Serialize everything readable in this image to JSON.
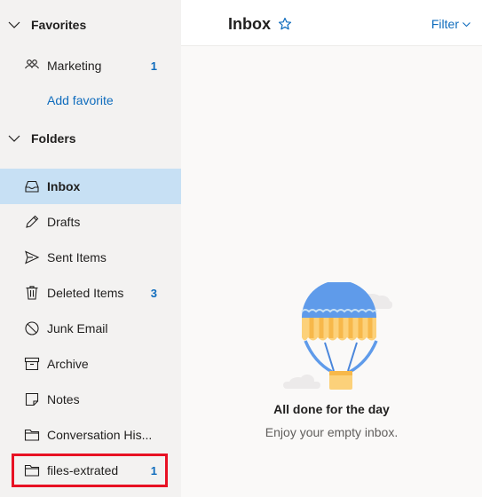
{
  "sidebar": {
    "favorites_header": "Favorites",
    "folders_header": "Folders",
    "add_favorite": "Add favorite",
    "favorites": [
      {
        "label": "Marketing",
        "count": "1",
        "icon": "people-icon"
      }
    ],
    "folders": [
      {
        "label": "Inbox",
        "count": "",
        "icon": "inbox-icon",
        "selected": true
      },
      {
        "label": "Drafts",
        "count": "",
        "icon": "pencil-icon"
      },
      {
        "label": "Sent Items",
        "count": "",
        "icon": "send-icon"
      },
      {
        "label": "Deleted Items",
        "count": "3",
        "icon": "trash-icon"
      },
      {
        "label": "Junk Email",
        "count": "",
        "icon": "block-icon"
      },
      {
        "label": "Archive",
        "count": "",
        "icon": "archive-icon"
      },
      {
        "label": "Notes",
        "count": "",
        "icon": "note-icon"
      },
      {
        "label": "Conversation His...",
        "count": "",
        "icon": "folder-icon"
      },
      {
        "label": "files-extrated",
        "count": "1",
        "icon": "folder-icon"
      }
    ]
  },
  "header": {
    "title": "Inbox",
    "filter_label": "Filter"
  },
  "empty_state": {
    "title": "All done for the day",
    "subtitle": "Enjoy your empty inbox."
  },
  "colors": {
    "accent": "#0f6cbd",
    "selected_bg": "#c7e0f4",
    "highlight": "#e81123"
  }
}
